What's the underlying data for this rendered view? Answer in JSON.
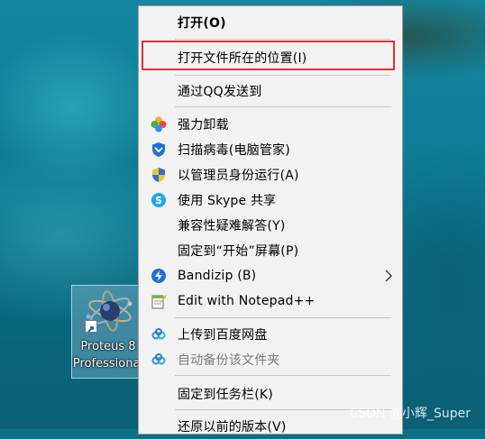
{
  "shortcut": {
    "label_line1": "Proteus 8",
    "label_line2": "Professional",
    "icon": "proteus-icon"
  },
  "menu": {
    "items": [
      {
        "label": "打开(O)",
        "bold": true
      },
      {
        "label": "打开文件所在的位置(I)",
        "highlighted": true
      },
      {
        "label": "通过QQ发送到"
      },
      {
        "label": "强力卸载",
        "icon": "power-uninstall-icon"
      },
      {
        "label": "扫描病毒(电脑管家)",
        "icon": "shield-scan-icon"
      },
      {
        "label": "以管理员身份运行(A)",
        "icon": "uac-shield-icon"
      },
      {
        "label": "使用 Skype 共享",
        "icon": "skype-icon"
      },
      {
        "label": "兼容性疑难解答(Y)"
      },
      {
        "label": "固定到“开始”屏幕(P)"
      },
      {
        "label": "Bandizip (B)",
        "icon": "bandizip-icon",
        "submenu": true
      },
      {
        "label": "Edit with Notepad++",
        "icon": "notepad-plus-plus-icon"
      },
      {
        "label": "上传到百度网盘",
        "icon": "baidu-cloud-icon"
      },
      {
        "label": "自动备份该文件夹",
        "icon": "baidu-cloud-icon",
        "disabled": true
      },
      {
        "label": "固定到任务栏(K)"
      },
      {
        "label": "还原以前的版本(V)"
      }
    ]
  },
  "watermark": "CSDN @小辉_Super",
  "colors": {
    "highlight_border": "#e03131",
    "menu_bg": "#f2f2f2"
  }
}
